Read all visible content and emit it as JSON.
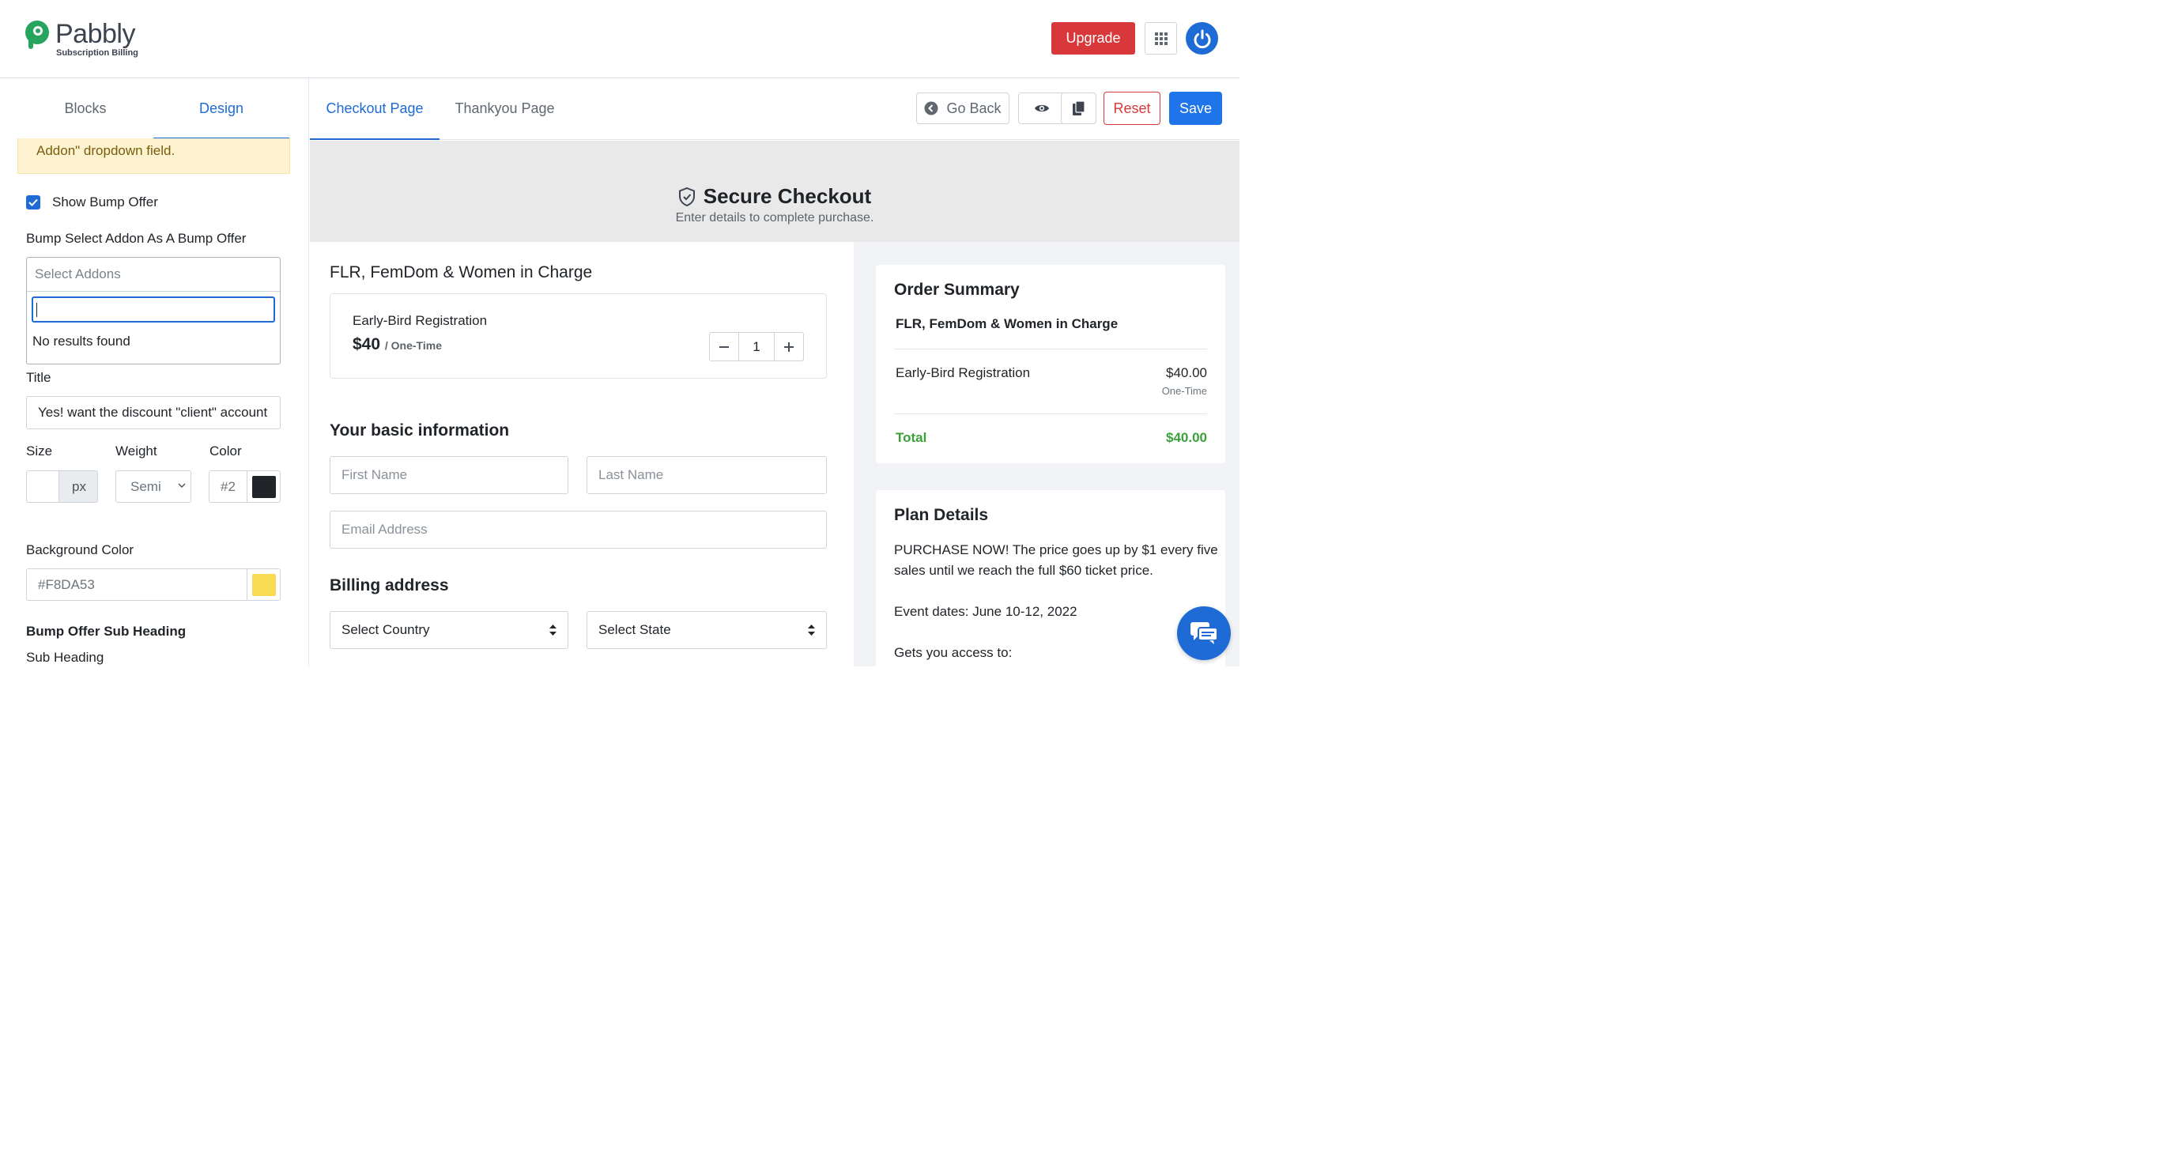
{
  "brand": {
    "name": "Pabbly",
    "subtitle": "Subscription Billing",
    "colors": {
      "primary": "#1e6bd6",
      "danger": "#d9383a",
      "success": "#3aa13a",
      "logo_green": "#27a55e"
    }
  },
  "header": {
    "upgrade_label": "Upgrade",
    "apps_icon": "grid-icon",
    "account_icon": "power-icon"
  },
  "left_panel": {
    "tabs": [
      {
        "label": "Blocks",
        "active": false
      },
      {
        "label": "Design",
        "active": true
      }
    ],
    "notice_text": "Addon\" dropdown field.",
    "show_bump_offer": {
      "label": "Show Bump Offer",
      "checked": true
    },
    "bump_select": {
      "label": "Bump Select Addon As A Bump Offer",
      "placeholder": "Select Addons",
      "search_value": "",
      "no_results": "No results found"
    },
    "title": {
      "label": "Title",
      "value": "Yes! want the discount \"client\" account"
    },
    "size": {
      "label": "Size",
      "value": "",
      "unit": "px"
    },
    "weight": {
      "label": "Weight",
      "value": "Semi"
    },
    "color": {
      "label": "Color",
      "value": "#2",
      "swatch": "#212529"
    },
    "background_color": {
      "label": "Background Color",
      "value": "#F8DA53",
      "swatch": "#F8DA53"
    },
    "sub_heading_section": "Bump Offer Sub Heading",
    "sub_heading_label": "Sub Heading"
  },
  "editor": {
    "tabs": [
      {
        "label": "Checkout Page",
        "active": true
      },
      {
        "label": "Thankyou Page",
        "active": false
      }
    ],
    "go_back_label": "Go Back",
    "preview_icon": "eye-icon",
    "copy_icon": "copy-icon",
    "reset_label": "Reset",
    "save_label": "Save"
  },
  "checkout": {
    "title": "Secure Checkout",
    "subtitle": "Enter details to complete purchase.",
    "product_name": "FLR, FemDom & Women in Charge",
    "plan": {
      "name": "Early-Bird Registration",
      "price": "$40",
      "period": "/ One-Time",
      "quantity": "1"
    },
    "basic_info_heading": "Your basic information",
    "first_name_placeholder": "First Name",
    "last_name_placeholder": "Last Name",
    "email_placeholder": "Email Address",
    "billing_heading": "Billing address",
    "country_select": "Select Country",
    "state_select": "Select State"
  },
  "order_summary": {
    "title": "Order Summary",
    "product": "FLR, FemDom & Women in Charge",
    "item_name": "Early-Bird Registration",
    "item_amount": "$40.00",
    "item_period": "One-Time",
    "total_label": "Total",
    "total_amount": "$40.00"
  },
  "plan_details": {
    "title": "Plan Details",
    "paragraph1": "PURCHASE NOW! The price goes up by $1 every five sales until we reach the full $60 ticket price.",
    "paragraph2": "Event dates: June 10-12, 2022",
    "paragraph3": "Gets you access to:"
  },
  "chat_icon": "chat-icon"
}
